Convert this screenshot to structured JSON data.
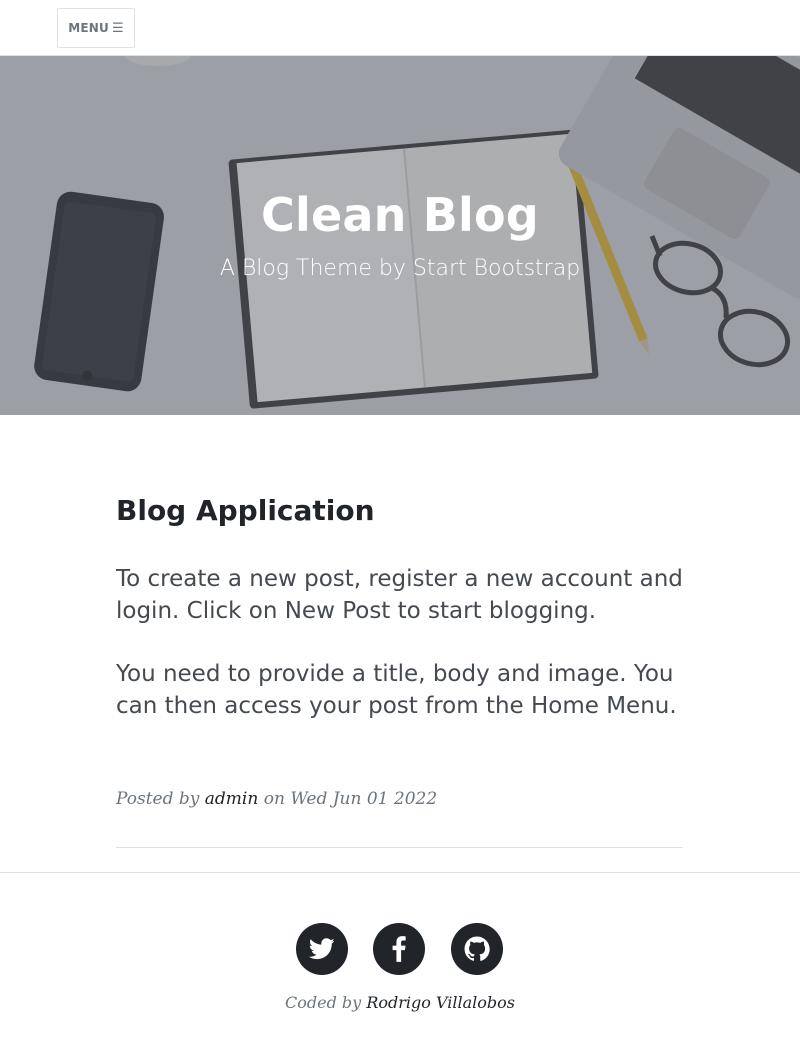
{
  "nav": {
    "menu_label": "MENU",
    "menu_icon": "hamburger-icon"
  },
  "header": {
    "title": "Clean Blog",
    "subtitle": "A Blog Theme by Start Bootstrap"
  },
  "post": {
    "title": "Blog Application",
    "paragraphs": [
      "To create a new post, register a new account and login. Click on New Post to start blogging.",
      "You need to provide a title, body and image. You can then access your post from the Home Menu."
    ],
    "meta_prefix": "Posted by",
    "author": "admin",
    "date_prefix": "on",
    "date": "Wed Jun 01 2022"
  },
  "footer": {
    "social": [
      "twitter-icon",
      "facebook-icon",
      "github-icon"
    ],
    "credit_prefix": "Coded by",
    "credit_author": "Rodrigo Villalobos"
  },
  "colors": {
    "text_dark": "#212529",
    "text_muted": "#6c757d",
    "border": "#dee2e6",
    "white": "#ffffff"
  }
}
